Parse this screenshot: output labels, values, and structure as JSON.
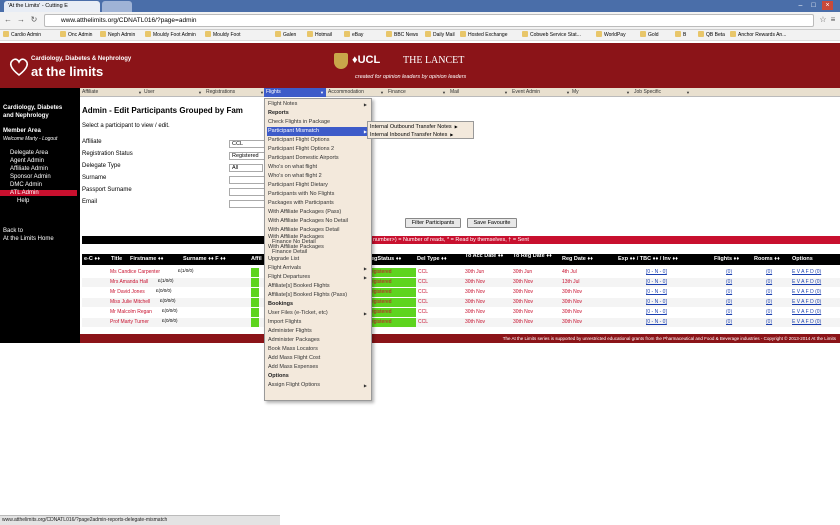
{
  "browser": {
    "tabs": [
      "'At the Limits' - Cutting E",
      ""
    ],
    "url": "www.atthelimits.org/CDNATL016/?page=admin",
    "status_url": "www.atthelimits.org/CDNATL016/?page2admin-reports-delegate-mismatch",
    "bookmarks": [
      "Cardio Admin",
      "Onc Admin",
      "Neph Admin",
      "Mouldy Foot Admin",
      "Mouldy Foot",
      "Galen",
      "Hotmail",
      "eBay",
      "BBC News",
      "Daily Mail",
      "Hosted Exchange",
      "Cobweb Service Stat...",
      "WorldPay",
      "Gold",
      "B",
      "QB Beta",
      "Anchor Rewards An..."
    ]
  },
  "header": {
    "logo_line1": "Cardiology, Diabetes & Nephrology",
    "logo_line2": "at the limits",
    "ucl": "♦UCL",
    "lancet": "THE LANCET",
    "tagline": "created for opinion leaders by opinion leaders"
  },
  "topmenu": [
    "Affiliate",
    "User",
    "Registrations",
    "Flights",
    "Accommodation",
    "Finance",
    "Mail",
    "Event Admin",
    "My",
    "Job Specific"
  ],
  "sidebar": {
    "title1": "Cardiology, Diabetes",
    "title2": "and Nephrology",
    "member": "Member Area",
    "welcome": "Welcome Marty - Logout",
    "links": [
      "Delegate Area",
      "Agent Admin",
      "Affiliate Admin",
      "Sponsor Admin",
      "DMC Admin",
      "ATL Admin",
      "Help"
    ],
    "back1": "Back to",
    "back2": "At the Limits Home"
  },
  "main": {
    "title": "Admin - Edit Participants Grouped by Fam",
    "instruction": "Select a participant to view / edit.",
    "fields": {
      "affiliate_label": "Affiliate",
      "affiliate_value": "CCL",
      "regstatus_label": "Registration Status",
      "regstatus_value": "Registered",
      "deltype_label": "Delegate Type",
      "deltype_value": "All",
      "surname_label": "Surname",
      "passport_label": "Passport Surname",
      "email_label": "Email"
    },
    "filter_button": "Filter Participants",
    "save_button": "Save Favourite",
    "legend": "number>) = Number of reads, * = Read by themselves, † = Sent"
  },
  "table": {
    "headers": [
      "e-C ♦♦",
      "Title",
      "Firstname ♦♦",
      "Surname ♦♦ F ♦♦",
      "Affil",
      "egStatus ♦♦",
      "Del Type ♦♦",
      "To Acc Date ♦♦",
      "To Reg Date ♦♦",
      "Reg Date ♦♦",
      "Exp ♦♦ / TBC ♦♦ / Inv ♦♦",
      "Flights ♦♦",
      "Rooms ♦♦",
      "Options"
    ],
    "rows": [
      {
        "name": "Ms Candice Carpenter",
        "code": "£(1/0/0)",
        "status": "egistered",
        "type": "CCL",
        "acc": "30th Jun",
        "reg": "30th Jun",
        "regdate": "4th Jul",
        "exp": "[0 - N - 0]",
        "flights": "(0)",
        "rooms": "(0)",
        "options": "E V A F D (0)"
      },
      {
        "name": "Mrs Amanda Hall",
        "code": "£(1/0/0)",
        "status": "egistered",
        "type": "CCL",
        "acc": "30th Nov",
        "reg": "30th Nov",
        "regdate": "13th Jul",
        "exp": "[0 - N - 0]",
        "flights": "(0)",
        "rooms": "(0)",
        "options": "E V A F D (0)"
      },
      {
        "name": "Mr David Jones",
        "code": "£(0/0/0)",
        "status": "egistered",
        "type": "CCL",
        "acc": "30th Nov",
        "reg": "30th Nov",
        "regdate": "30th Nov",
        "exp": "[0 - N - 0]",
        "flights": "(0)",
        "rooms": "(0)",
        "options": "E V A F D (0)"
      },
      {
        "name": "Miss Julie Mitchell",
        "code": "£(0/0/0)",
        "status": "egistered",
        "type": "CCL",
        "acc": "30th Nov",
        "reg": "30th Nov",
        "regdate": "30th Nov",
        "exp": "[0 - N - 0]",
        "flights": "(0)",
        "rooms": "(0)",
        "options": "E V A F D (0)"
      },
      {
        "name": "Mr Malcolm Regan",
        "code": "£(0/0/0)",
        "status": "egistered",
        "type": "CCL",
        "acc": "30th Nov",
        "reg": "30th Nov",
        "regdate": "30th Nov",
        "exp": "[0 - N - 0]",
        "flights": "(0)",
        "rooms": "(0)",
        "options": "E V A F D (0)"
      },
      {
        "name": "Prof Marty Turner",
        "code": "£(0/0/0)",
        "status": "egistered",
        "type": "CCL",
        "acc": "30th Nov",
        "reg": "30th Nov",
        "regdate": "30th Nov",
        "exp": "[0 - N - 0]",
        "flights": "(0)",
        "rooms": "(0)",
        "options": "E V A F D (0)"
      }
    ]
  },
  "footer": "The At the Limits series is supported by unrestricted educational grants from the Pharmaceutical and Food & Beverage industries - Copyright © 2013-2014 At the Limits",
  "dropdown": {
    "items": [
      {
        "label": "Flight Notes",
        "type": "item",
        "arrow": true
      },
      {
        "label": "Reports",
        "type": "section"
      },
      {
        "label": "Check Flights in Package",
        "type": "item"
      },
      {
        "label": "Participant Mismatch",
        "type": "selected",
        "arrow": true
      },
      {
        "label": "Participant Flight Options",
        "type": "item"
      },
      {
        "label": "Participant Flight Options 2",
        "type": "item"
      },
      {
        "label": "Participant Domestic Airports",
        "type": "item"
      },
      {
        "label": "Who's on what flight",
        "type": "item"
      },
      {
        "label": "Who's on what flight 2",
        "type": "item"
      },
      {
        "label": "Participant Flight Dietary",
        "type": "item"
      },
      {
        "label": "Participants with No Flights",
        "type": "item"
      },
      {
        "label": "Packages with Participants",
        "type": "item"
      },
      {
        "label": "With Affiliate Packages (Pass)",
        "type": "item"
      },
      {
        "label": "With Affiliate Packages No Detail",
        "type": "item"
      },
      {
        "label": "With Affiliate Packages Detail",
        "type": "item"
      },
      {
        "label": "With Affiliate Packages",
        "sub": "Finance No Detail",
        "type": "twoline"
      },
      {
        "label": "With Affiliate Packages",
        "sub": "Finance Detail",
        "type": "twoline"
      },
      {
        "label": "Upgrade List",
        "type": "item"
      },
      {
        "label": "Flight Arrivals",
        "type": "item",
        "arrow": true
      },
      {
        "label": "Flight Departures",
        "type": "item",
        "arrow": true
      },
      {
        "label": "Affiliate[s] Booked Flights",
        "type": "item"
      },
      {
        "label": "Affiliate[s] Booked Flights (Pass)",
        "type": "item"
      },
      {
        "label": "Bookings",
        "type": "section"
      },
      {
        "label": "User Files (e-Ticket, etc)",
        "type": "item",
        "arrow": true
      },
      {
        "label": "Import Flights",
        "type": "item"
      },
      {
        "label": "Administer Flights",
        "type": "item"
      },
      {
        "label": "Administer Packages",
        "type": "item"
      },
      {
        "label": "Book Mass Locators",
        "type": "item"
      },
      {
        "label": "Add Mass Flight Cost",
        "type": "item"
      },
      {
        "label": "Add Mass Expenses",
        "type": "item"
      },
      {
        "label": "Options",
        "type": "section"
      },
      {
        "label": "Assign Flight Options",
        "type": "item",
        "arrow": true
      }
    ],
    "submenu": [
      "Internal Outbound Transfer Notes",
      "Internal Inbound Transfer Notes"
    ]
  },
  "colors": {
    "brand_red": "#8b1418",
    "accent_red": "#c8102e",
    "menu_blue": "#3d5bc9",
    "status_green": "#5ed41e"
  }
}
